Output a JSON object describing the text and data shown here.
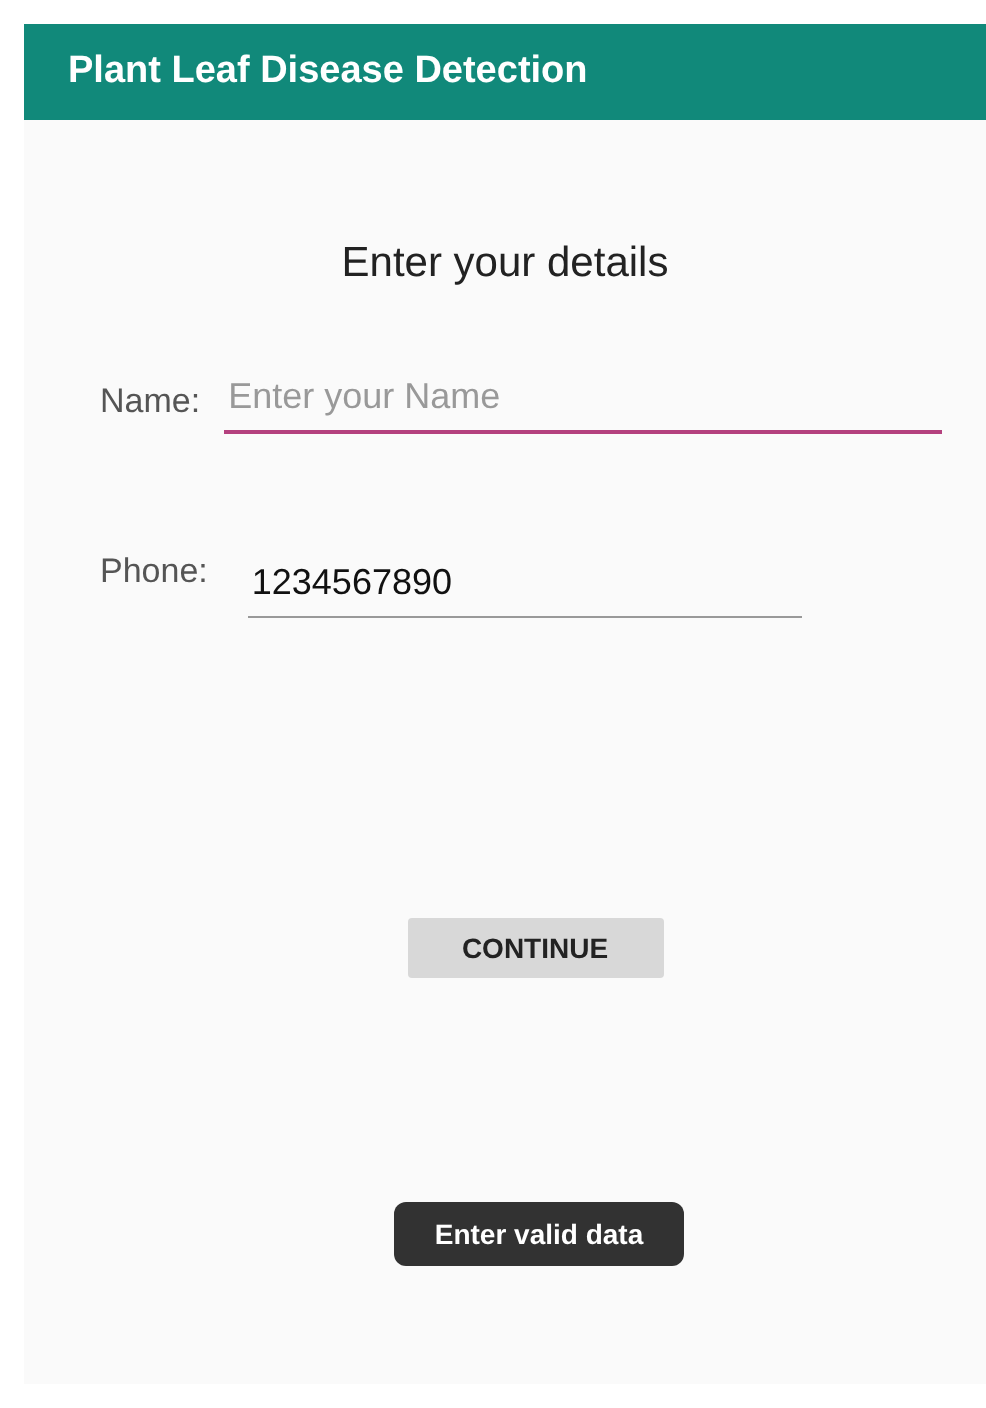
{
  "app_bar": {
    "title": "Plant Leaf Disease Detection"
  },
  "heading": "Enter your details",
  "fields": [
    {
      "label": "Name:",
      "placeholder": "Enter your Name",
      "focused": true
    },
    {
      "label": "Phone:",
      "value": "1234567890",
      "focused": false
    }
  ],
  "button": {
    "label": "CONTINUE"
  },
  "toast": {
    "text": "Enter valid data"
  }
}
